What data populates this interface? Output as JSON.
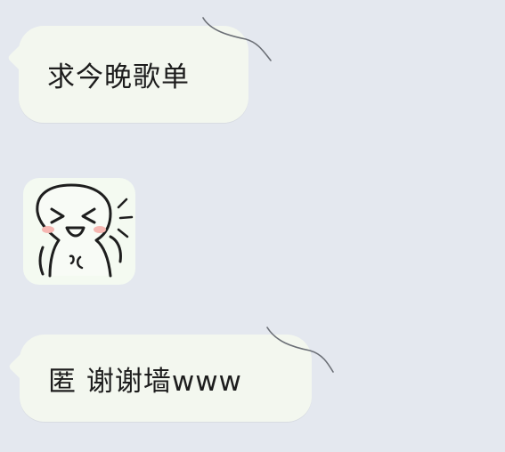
{
  "conversation": {
    "messages": [
      {
        "type": "text",
        "text": "求今晚歌单"
      },
      {
        "type": "sticker",
        "icon": "laughing-face-sticker"
      },
      {
        "type": "text",
        "text": "匿  谢谢墙www"
      }
    ]
  },
  "colors": {
    "background": "#e4e8ef",
    "bubble": "#f3f7ef",
    "text": "#1d1d1d"
  }
}
